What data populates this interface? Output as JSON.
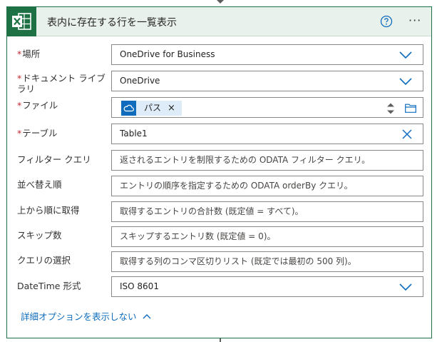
{
  "header": {
    "title": "表内に存在する行を一覧表示",
    "app_icon": "excel-icon",
    "help_icon": "help-circle-icon",
    "more_icon": "more-horizontal-icon",
    "more_glyph": "···"
  },
  "fields": {
    "location": {
      "label": "場所",
      "required_mark": "*",
      "value": "OneDrive for Business"
    },
    "doc_library": {
      "label_line1": "ドキュメント ライブ",
      "label_line2": "ラリ",
      "required_mark": "*",
      "value": "OneDrive"
    },
    "file": {
      "label": "ファイル",
      "required_mark": "*",
      "token_label": "パス",
      "token_remove": "×",
      "token_icon": "onedrive-cloud-icon"
    },
    "table": {
      "label": "テーブル",
      "required_mark": "*",
      "value": "Table1"
    },
    "filter_query": {
      "label": "フィルター クエリ",
      "placeholder": "返されるエントリを制限するための ODATA フィルター クエリ。"
    },
    "order_by": {
      "label": "並べ替え順",
      "placeholder": "エントリの順序を指定するための ODATA orderBy クエリ。"
    },
    "top_count": {
      "label": "上から順に取得",
      "placeholder": "取得するエントリの合計数 (既定値 = すべて)。"
    },
    "skip_count": {
      "label": "スキップ数",
      "placeholder": "スキップするエントリ数 (既定値 = 0)。"
    },
    "select_query": {
      "label": "クエリの選択",
      "placeholder": "取得する列のコンマ区切りリスト (既定では最初の 500 列)。"
    },
    "datetime_format": {
      "label": "DateTime 形式",
      "value": "ISO 8601"
    }
  },
  "advanced": {
    "label": "詳細オプションを表示しない"
  },
  "colors": {
    "excel_green": "#1e7145",
    "header_bg": "#e9f1ec",
    "accent_blue": "#0f6cbd",
    "required_red": "#c0272d",
    "token_bg": "#deecf9"
  }
}
